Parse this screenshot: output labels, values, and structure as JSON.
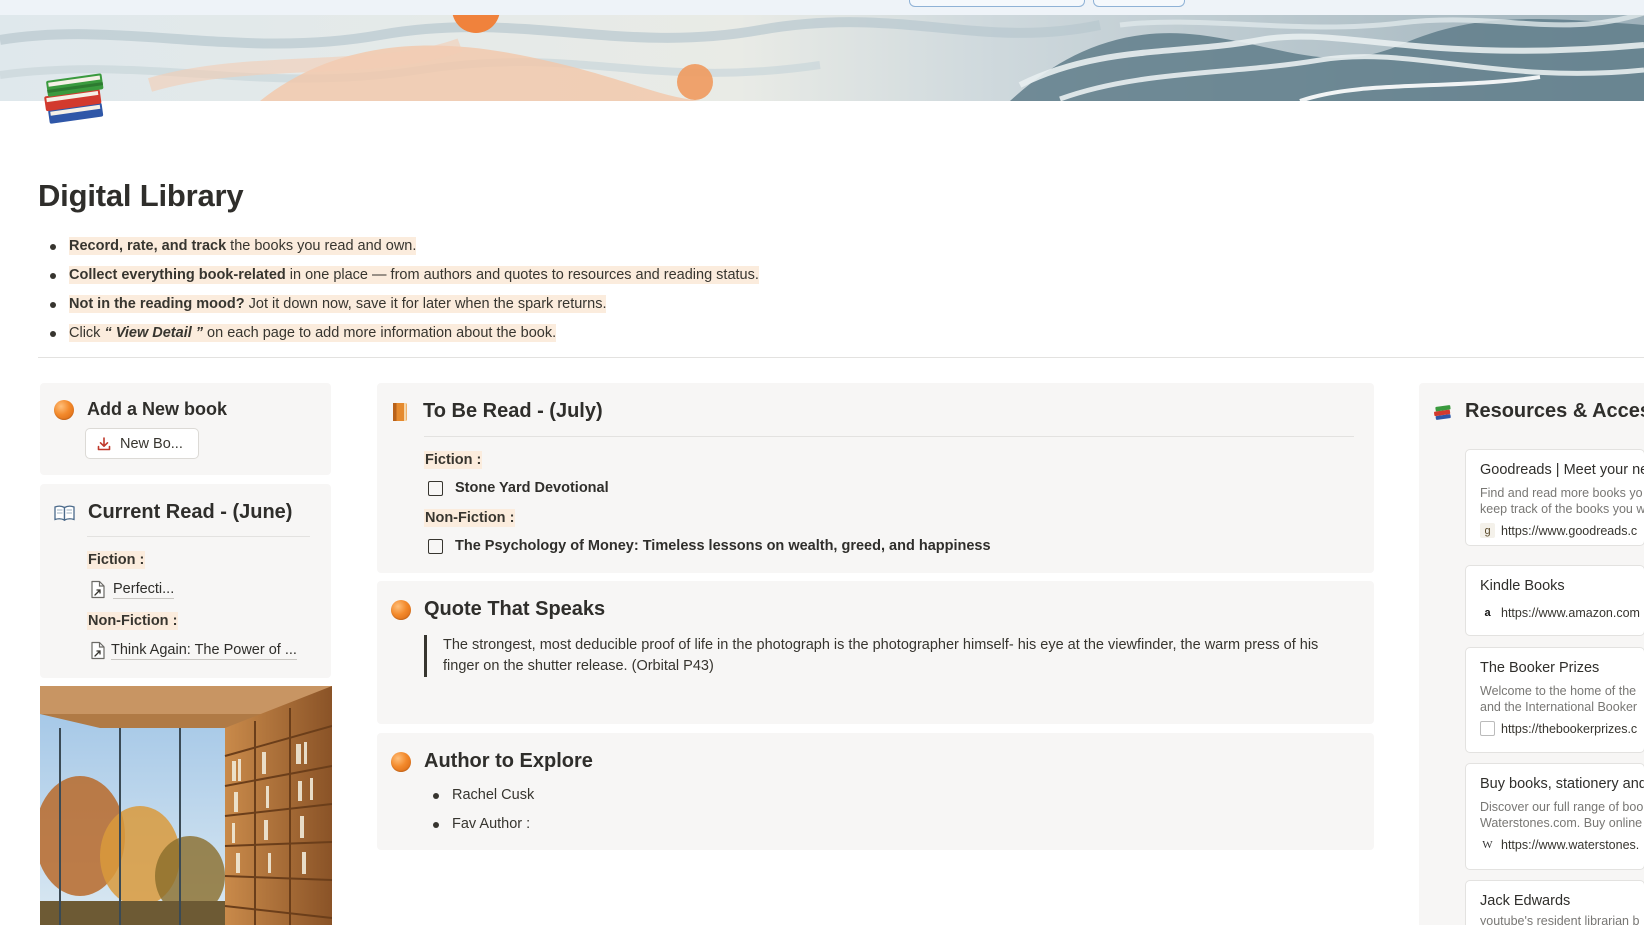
{
  "page": {
    "title": "Digital Library"
  },
  "intro": [
    {
      "bold": "Record, rate, and track",
      "rest": " the books you read and own."
    },
    {
      "bold": "Collect everything book-related",
      "rest": " in one place — from authors and quotes to resources and reading status."
    },
    {
      "bold": "Not in the reading mood?",
      "rest": " Jot it down now, save it for later when the spark returns."
    },
    {
      "pre": "Click ",
      "emph": "“ View Detail ”",
      "rest": " on each page to add more information about the book."
    }
  ],
  "add_book": {
    "title": "Add a New book",
    "button_label": "New Bo..."
  },
  "current_read": {
    "title": "Current Read - (June)",
    "fiction_label": "Fiction :",
    "fiction_book": "Perfecti...",
    "nonfiction_label": "Non-Fiction :",
    "nonfiction_book": "Think Again: The Power of ..."
  },
  "to_be_read": {
    "title": "To Be Read - (July)",
    "fiction_label": "Fiction :",
    "fiction_book": "Stone Yard Devotional",
    "nonfiction_label": "Non-Fiction :",
    "nonfiction_book": "The Psychology of Money: Timeless lessons on wealth, greed, and happiness"
  },
  "quote": {
    "title": "Quote That Speaks",
    "text": "The strongest, most deducible proof of life in the photograph is the photographer himself- his eye at the viewfinder, the warm press of his finger on the shutter release. (Orbital P43)"
  },
  "authors": {
    "title": "Author to Explore",
    "items": [
      "Rachel Cusk",
      "Fav Author :"
    ]
  },
  "resources": {
    "title": "Resources & Acces",
    "bookmarks": [
      {
        "title": "Goodreads | Meet your ne",
        "desc": [
          "Find and read more books yo",
          "keep track of the books you w"
        ],
        "favicon": "g",
        "url": "https://www.goodreads.c"
      },
      {
        "title": "Kindle Books",
        "desc": [],
        "favicon": "a",
        "url": "https://www.amazon.com"
      },
      {
        "title": "The Booker Prizes",
        "desc": [
          "Welcome to the home of the",
          "and the International Booker"
        ],
        "favicon": "",
        "url": "https://thebookerprizes.c"
      },
      {
        "title": "Buy books, stationery and",
        "desc": [
          "Discover our full range of boo",
          "Waterstones.com. Buy online"
        ],
        "favicon": "W",
        "url": "https://www.waterstones."
      },
      {
        "title": "Jack Edwards",
        "desc": [
          "youtube's resident librarian b"
        ],
        "favicon": "",
        "url": ""
      }
    ]
  },
  "icons": {
    "page": "books-stack-icon",
    "orb": "orange-circle-icon",
    "open_book": "open-book-icon",
    "closed_book": "orange-book-icon",
    "stack": "books-icon",
    "import": "download-icon",
    "page_link": "page-link-icon"
  },
  "colors": {
    "highlight": "#fbecdd",
    "card_bg": "#f7f6f5",
    "accent_orange": "#f38a2c",
    "text": "#37352f"
  }
}
